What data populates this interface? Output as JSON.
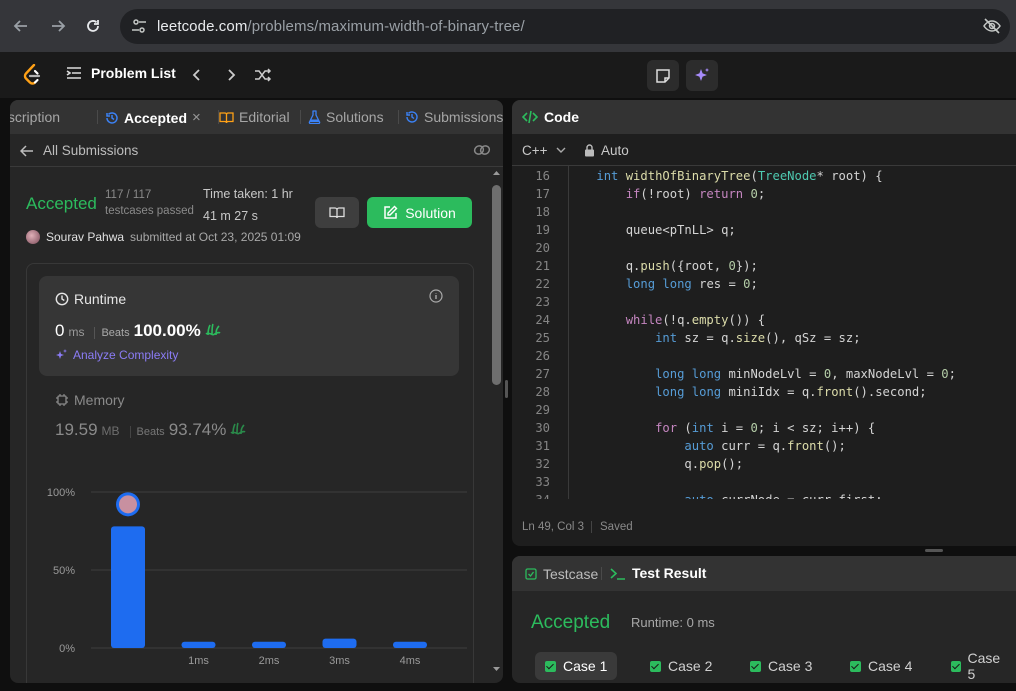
{
  "browser": {
    "url_host": "leetcode.com",
    "url_path": "/problems/maximum-width-of-binary-tree/"
  },
  "header": {
    "problem_list_label": "Problem List"
  },
  "left_tabs": {
    "description": "Description",
    "accepted": "Accepted",
    "editorial": "Editorial",
    "solutions": "Solutions",
    "submissions": "Submissions"
  },
  "submission": {
    "back_label": "All Submissions",
    "status": "Accepted",
    "testcases_count": "117 / 117",
    "testcases_label": "testcases passed",
    "time_taken_line1": "Time taken: 1 hr",
    "time_taken_line2": "41 m 27 s",
    "solution_button": "Solution",
    "submitter_name": "Sourav Pahwa",
    "submitted_text": "submitted at Oct 23, 2025 01:09"
  },
  "runtime": {
    "title": "Runtime",
    "value": "0",
    "unit": "ms",
    "beats_label": "Beats",
    "beats_pct": "100.00%",
    "analyze_label": "Analyze Complexity"
  },
  "memory": {
    "title": "Memory",
    "value": "19.59",
    "unit": "MB",
    "beats_label": "Beats",
    "beats_pct": "93.74%"
  },
  "chart_data": {
    "type": "bar",
    "categories": [
      "0ms",
      "1ms",
      "2ms",
      "3ms",
      "4ms"
    ],
    "category_labels": [
      "",
      "1ms",
      "2ms",
      "3ms",
      "4ms"
    ],
    "values": [
      78,
      4,
      4,
      6,
      4
    ],
    "ylim": [
      0,
      100
    ],
    "yticks": [
      "100%",
      "50%",
      "0%"
    ],
    "ytick_values": [
      100,
      50,
      0
    ],
    "bar_color": "#1e6cf0",
    "highlight_index": 0
  },
  "code": {
    "tab_label": "Code",
    "language": "C++",
    "mode": "Auto",
    "status_position": "Ln 49, Col 3",
    "status_saved": "Saved",
    "start_line": 16,
    "lines": [
      "    int widthOfBinaryTree(TreeNode* root) {",
      "        if(!root) return 0;",
      "",
      "        queue<pTnLL> q;",
      "",
      "        q.push({root, 0});",
      "        long long res = 0;",
      "",
      "        while(!q.empty()) {",
      "            int sz = q.size(), qSz = sz;",
      "",
      "            long long minNodeLvl = 0, maxNodeLvl = 0;",
      "            long long miniIdx = q.front().second;",
      "",
      "            for (int i = 0; i < sz; i++) {",
      "                auto curr = q.front();",
      "                q.pop();",
      "",
      "                auto currNode = curr.first;"
    ]
  },
  "test": {
    "testcase_tab": "Testcase",
    "result_tab": "Test Result",
    "status": "Accepted",
    "runtime": "Runtime: 0 ms",
    "cases": [
      "Case 1",
      "Case 2",
      "Case 3",
      "Case 4",
      "Case 5"
    ]
  },
  "colors": {
    "accepted_green": "#2cbb5d",
    "accent_purple": "#8b7cf6",
    "bar_blue": "#1e6cf0"
  }
}
